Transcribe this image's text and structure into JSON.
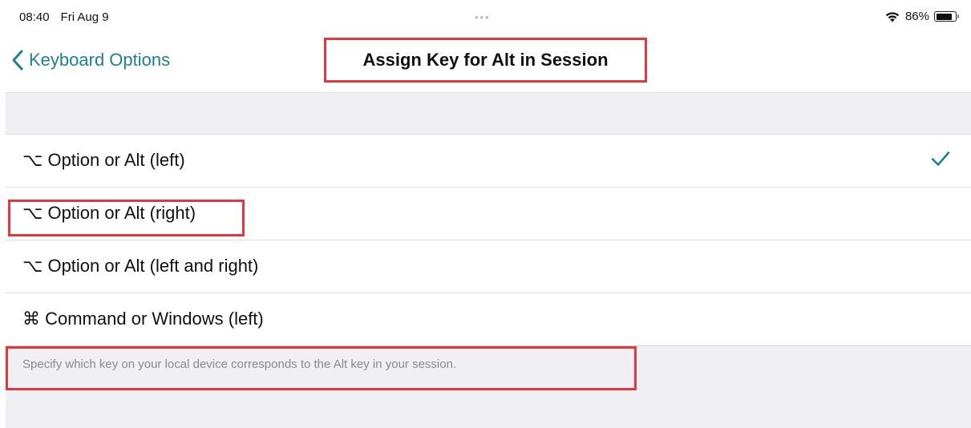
{
  "status_bar": {
    "time": "08:40",
    "date": "Fri Aug 9",
    "dots": "•••",
    "battery_percent": "86%",
    "battery_level": 0.86,
    "icons": [
      "wifi-icon",
      "battery-icon"
    ]
  },
  "nav": {
    "back_label": "Keyboard Options",
    "back_icon": "chevron-left-icon",
    "title": "Assign Key for Alt in Session"
  },
  "options": [
    {
      "label": "⌥ Option or Alt (left)",
      "selected": true
    },
    {
      "label": "⌥ Option or Alt (right)",
      "selected": false
    },
    {
      "label": "⌥ Option or Alt (left and right)",
      "selected": false
    },
    {
      "label": "⌘ Command or Windows (left)",
      "selected": false
    }
  ],
  "footer": {
    "note": "Specify which key on your local device corresponds to the Alt key in your session."
  },
  "colors": {
    "accent": "#1f7f92",
    "highlight": "#e2373c",
    "group_background": "#efeff4",
    "secondary_text": "#8a8a8e"
  }
}
